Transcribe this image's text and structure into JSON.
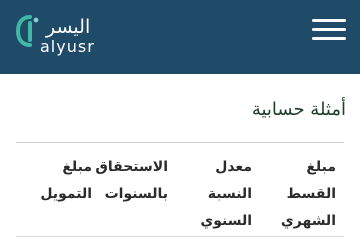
{
  "header": {
    "background_color": "#1f4a68",
    "logo": {
      "arabic_text": "اليسر",
      "latin_text": "alyusr",
      "mark_color": "#3fb8a6"
    },
    "menu_icon": "hamburger-menu-icon"
  },
  "main": {
    "section_title": "أمثلة حسابية",
    "table": {
      "columns": [
        "مبلغ\nالتمويل",
        "الاستحقاق\nبالسنوات",
        "معدل\nالنسبة\nالسنوي",
        "مبلغ\nالقسط\nالشهري"
      ]
    }
  }
}
